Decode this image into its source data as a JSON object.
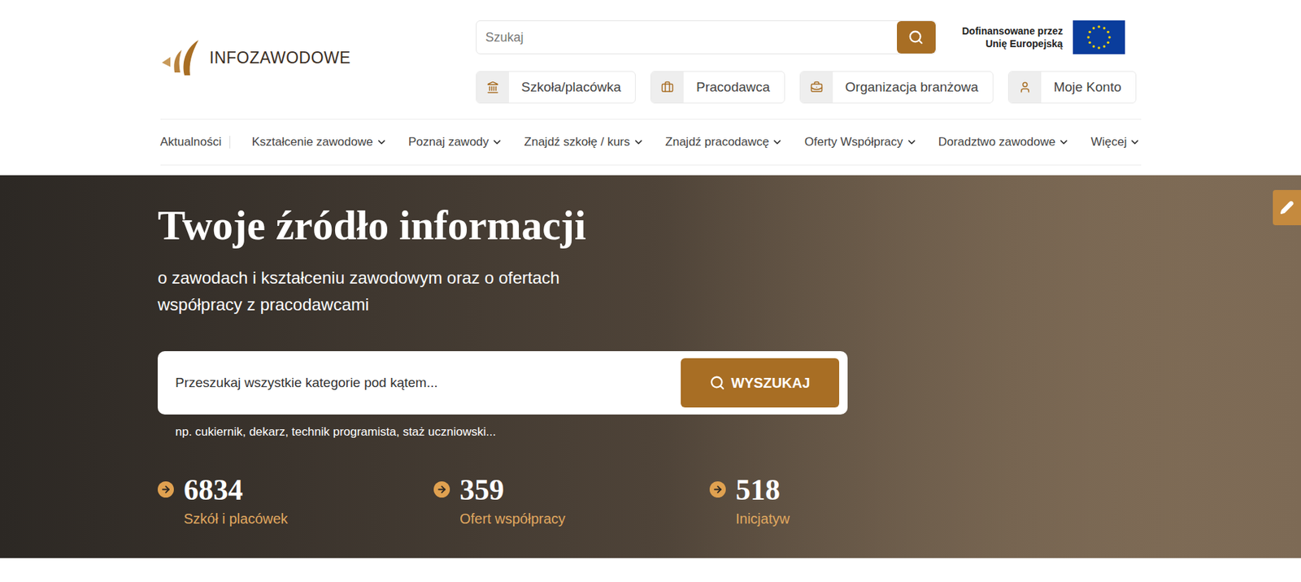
{
  "header": {
    "logo_text": "INFOZAWODOWE",
    "search": {
      "placeholder": "Szukaj"
    },
    "eu_badge": {
      "line1": "Dofinansowane przez",
      "line2": "Unię Europejską"
    },
    "account_buttons": [
      {
        "label": "Szkoła/placówka",
        "kind": "school"
      },
      {
        "label": "Pracodawca",
        "kind": "employer"
      },
      {
        "label": "Organizacja branżowa",
        "kind": "organization"
      },
      {
        "label": "Moje Konto",
        "kind": "account"
      }
    ]
  },
  "nav": {
    "items": [
      {
        "label": "Aktualności",
        "dropdown": false
      },
      {
        "label": "Kształcenie zawodowe",
        "dropdown": true
      },
      {
        "label": "Poznaj zawody",
        "dropdown": true
      },
      {
        "label": "Znajdź szkołę / kurs",
        "dropdown": true
      },
      {
        "label": "Znajdź pracodawcę",
        "dropdown": true
      },
      {
        "label": "Oferty Współpracy",
        "dropdown": true
      },
      {
        "label": "Doradztwo zawodowe",
        "dropdown": true
      },
      {
        "label": "Więcej",
        "dropdown": true
      }
    ]
  },
  "hero": {
    "title": "Twoje źródło informacji",
    "subtitle": "o zawodach i kształceniu zawodowym oraz o ofertach współpracy z pracodawcami",
    "search": {
      "placeholder": "Przeszukaj wszystkie kategorie pod kątem...",
      "button": "WYSZUKAJ"
    },
    "hint": "np. cukiernik, dekarz, technik programista, staż uczniowski...",
    "stats": [
      {
        "value": "6834",
        "label": "Szkół i placówek"
      },
      {
        "value": "359",
        "label": "Ofert współpracy"
      },
      {
        "value": "518",
        "label": "Inicjatyw"
      }
    ]
  }
}
